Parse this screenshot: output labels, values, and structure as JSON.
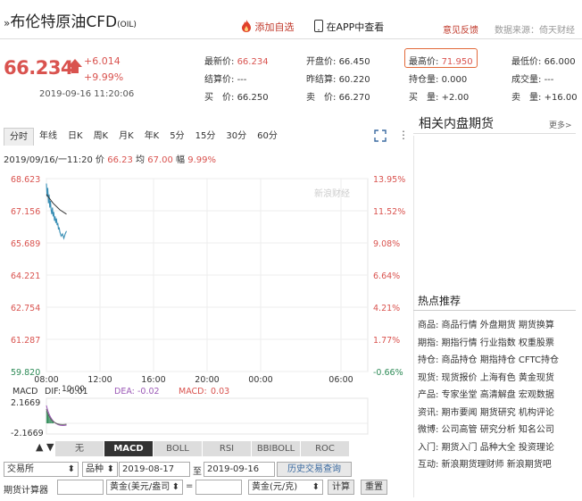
{
  "header": {
    "title_prefix": "»",
    "title": "布伦特原油CFD",
    "symbol": "(OIL)",
    "add_watch": "添加自选",
    "view_in_app": "在APP中查看",
    "feedback": "意见反馈",
    "source": "数据来源：倚天财经"
  },
  "quote": {
    "price": "66.234",
    "change": "+6.014",
    "change_pct": "+9.99%",
    "time": "2019-09-16 11:20:06",
    "fields": {
      "latest_label": "最新价:",
      "latest": "66.234",
      "open_label": "开盘价:",
      "open": "66.450",
      "high_label": "最高价:",
      "high": "71.950",
      "low_label": "最低价:",
      "low": "66.000",
      "settle_label": "结算价:",
      "settle": "---",
      "prev_label": "昨结算:",
      "prev": "60.220",
      "oi_label": "持仓量:",
      "oi": "0.000",
      "vol_label": "成交量:",
      "vol": "---",
      "bid_label": "买　价:",
      "bid": "66.250",
      "ask_label": "卖　价:",
      "ask": "66.270",
      "bidvol_label": "买　量:",
      "bidvol": "+2.00",
      "askvol_label": "卖　量:",
      "askvol": "+16.00"
    }
  },
  "tabs": [
    "分时",
    "年线",
    "日K",
    "周K",
    "月K",
    "年K",
    "5分",
    "15分",
    "30分",
    "60分"
  ],
  "infoline": {
    "prefix": "2019/09/16/一11:20 价",
    "price": "66.23",
    "avg_label": "均",
    "avg": "67.00",
    "fu_label": "幅",
    "pct": "9.99%"
  },
  "chart_data": {
    "type": "line",
    "title": "",
    "watermark": "新浪财经",
    "x_ticks": [
      "08:00",
      "12:00",
      "16:00",
      "20:00",
      "00:00",
      "06:00"
    ],
    "x_tick_sub": [
      "10:00"
    ],
    "y_ticks_left": [
      "68.623",
      "67.156",
      "65.689",
      "64.221",
      "62.754",
      "61.287",
      "59.820"
    ],
    "y_ticks_right": [
      "13.95%",
      "11.52%",
      "9.08%",
      "6.64%",
      "4.21%",
      "1.77%",
      "-0.66%"
    ],
    "ylim": [
      59.82,
      68.623
    ],
    "xlim_hours": [
      8,
      32
    ],
    "series": [
      {
        "x": [
          8.0,
          8.05,
          8.1,
          8.15,
          8.2,
          8.25,
          8.3,
          8.35,
          8.4,
          8.45,
          8.5,
          8.55,
          8.6,
          8.65,
          8.7,
          8.75,
          8.8,
          8.85,
          8.9,
          8.95,
          9.0,
          9.1,
          9.2,
          9.3,
          9.4,
          9.5
        ],
        "y": [
          68.4,
          67.8,
          68.2,
          67.5,
          67.9,
          67.3,
          67.6,
          67.2,
          67.0,
          67.3,
          66.9,
          67.1,
          66.7,
          66.9,
          66.6,
          66.8,
          66.5,
          66.6,
          66.3,
          66.4,
          66.2,
          66.0,
          66.1,
          65.9,
          66.1,
          66.23
        ]
      },
      {
        "x": [
          8.0,
          8.5,
          9.0,
          9.5
        ],
        "y": [
          67.9,
          67.5,
          67.2,
          67.0
        ]
      }
    ],
    "colors": {
      "price": "#3a8fb5",
      "avg": "#333333",
      "up": "#d9534f",
      "down": "#2e8b57"
    }
  },
  "macd": {
    "label": "MACD",
    "dif_label": "DIF:",
    "dif": "-0.01",
    "dea_label": "DEA:",
    "dea": "-0.02",
    "macd_label": "MACD:",
    "macd": "0.03",
    "y_top": "2.1669",
    "y_bottom": "-2.1669"
  },
  "indicators": [
    "无",
    "MACD",
    "BOLL",
    "RSI",
    "BBIBOLL",
    "ROC"
  ],
  "form": {
    "exchange": "交易所",
    "variety": "品种",
    "date_from": "2019-08-17",
    "to": "至",
    "date_to": "2019-09-16",
    "query": "历史交易查询",
    "calc_label": "期货计算器",
    "unit1": "黄金(美元/盎司",
    "eq": "=",
    "unit2": "黄金(元/克)",
    "calc": "计算",
    "reset": "重置"
  },
  "right_panel": {
    "title": "相关内盘期货",
    "more": "更多>",
    "hot_title": "热点推荐",
    "rows": [
      "商品:  商品行情  外盘期货  期货换算",
      "期指:  期指行情  行业指数  权重股票",
      "持仓:  商品持仓  期指持仓  CFTC持仓",
      "现货:  现货报价  上海有色  黄金现货",
      "产品:  专家坐堂  高清解盘  宏观数据",
      "资讯:  期市要闻  期货研究  机构评论",
      "微博:  公司高管  研究分析  知名公司",
      "入门:  期货入门  品种大全  投资理论",
      "互动:  新浪期货理财师  新浪期货吧"
    ]
  }
}
